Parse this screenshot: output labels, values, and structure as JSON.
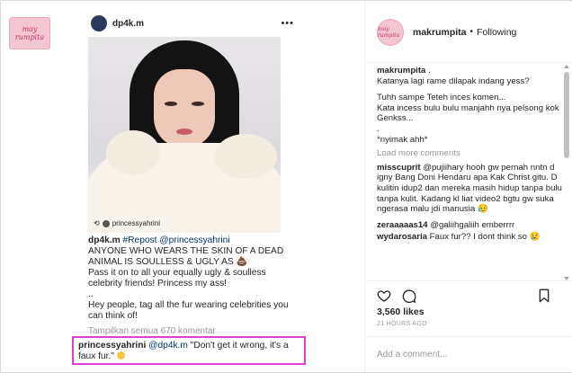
{
  "brand": {
    "logo_text": "may rumpita"
  },
  "inner_post": {
    "username": "dp4k.m",
    "more": "•••",
    "tag_user": "princessyahrini",
    "caption_user": "dp4k.m",
    "caption_repost": "#Repost @princessyahrini",
    "caption_line1": "ANYONE WHO WEARS THE SKIN OF A DEAD ANIMAL IS SOULLESS & UGLY AS 💩",
    "caption_line2": "Pass it on to all your equally ugly & soulless celebrity friends! Princess my ass!",
    "caption_dot": "..",
    "caption_line3": "Hey people, tag all the fur wearing celebrities you can think of!",
    "view_all": "Tampilkan semua 670 komentar",
    "reply_user": "princessyahrini",
    "reply_mention": "@dp4k.m",
    "reply_text": "\"Don't get it wrong, it's a faux fur.\""
  },
  "header": {
    "username": "makrumpita",
    "dot": "•",
    "follow_status": "Following",
    "avatar_text": "may rumpita"
  },
  "caption": {
    "user": "makrumpita",
    "lines": [
      "makrumpita .",
      "Katanya lagi rame dilapak indang yess?",
      "Tuhh sampe Teteh inces komen...",
      "Kata incess bulu bulu manjahh nya pelsong kok Genkss...",
      ".",
      "*nyimak ahh*"
    ]
  },
  "load_more": "Load more comments",
  "comments": [
    {
      "user": "misscuprit",
      "text": "@pujiihary hooh gw pernah nntn d igny Bang Doni Hendaru apa Kak Christ gitu. D kulitin idup2 dan mereka masih hidup tanpa bulu tanpa kulit. Kadang kl liat video2 bgtu gw suka ngerasa malu jdi manusia 😥"
    },
    {
      "user": "zeraaaaas14",
      "text": "@galiihgaliih emberrrr"
    },
    {
      "user": "wydarosaria",
      "text": "Faux fur?? I dont think so 😢"
    }
  ],
  "likes": "3,560 likes",
  "time": "21 HOURS AGO",
  "add_comment_placeholder": "Add a comment...",
  "colors": {
    "highlight": "#e040d0",
    "link": "#003569",
    "muted": "#999999"
  }
}
